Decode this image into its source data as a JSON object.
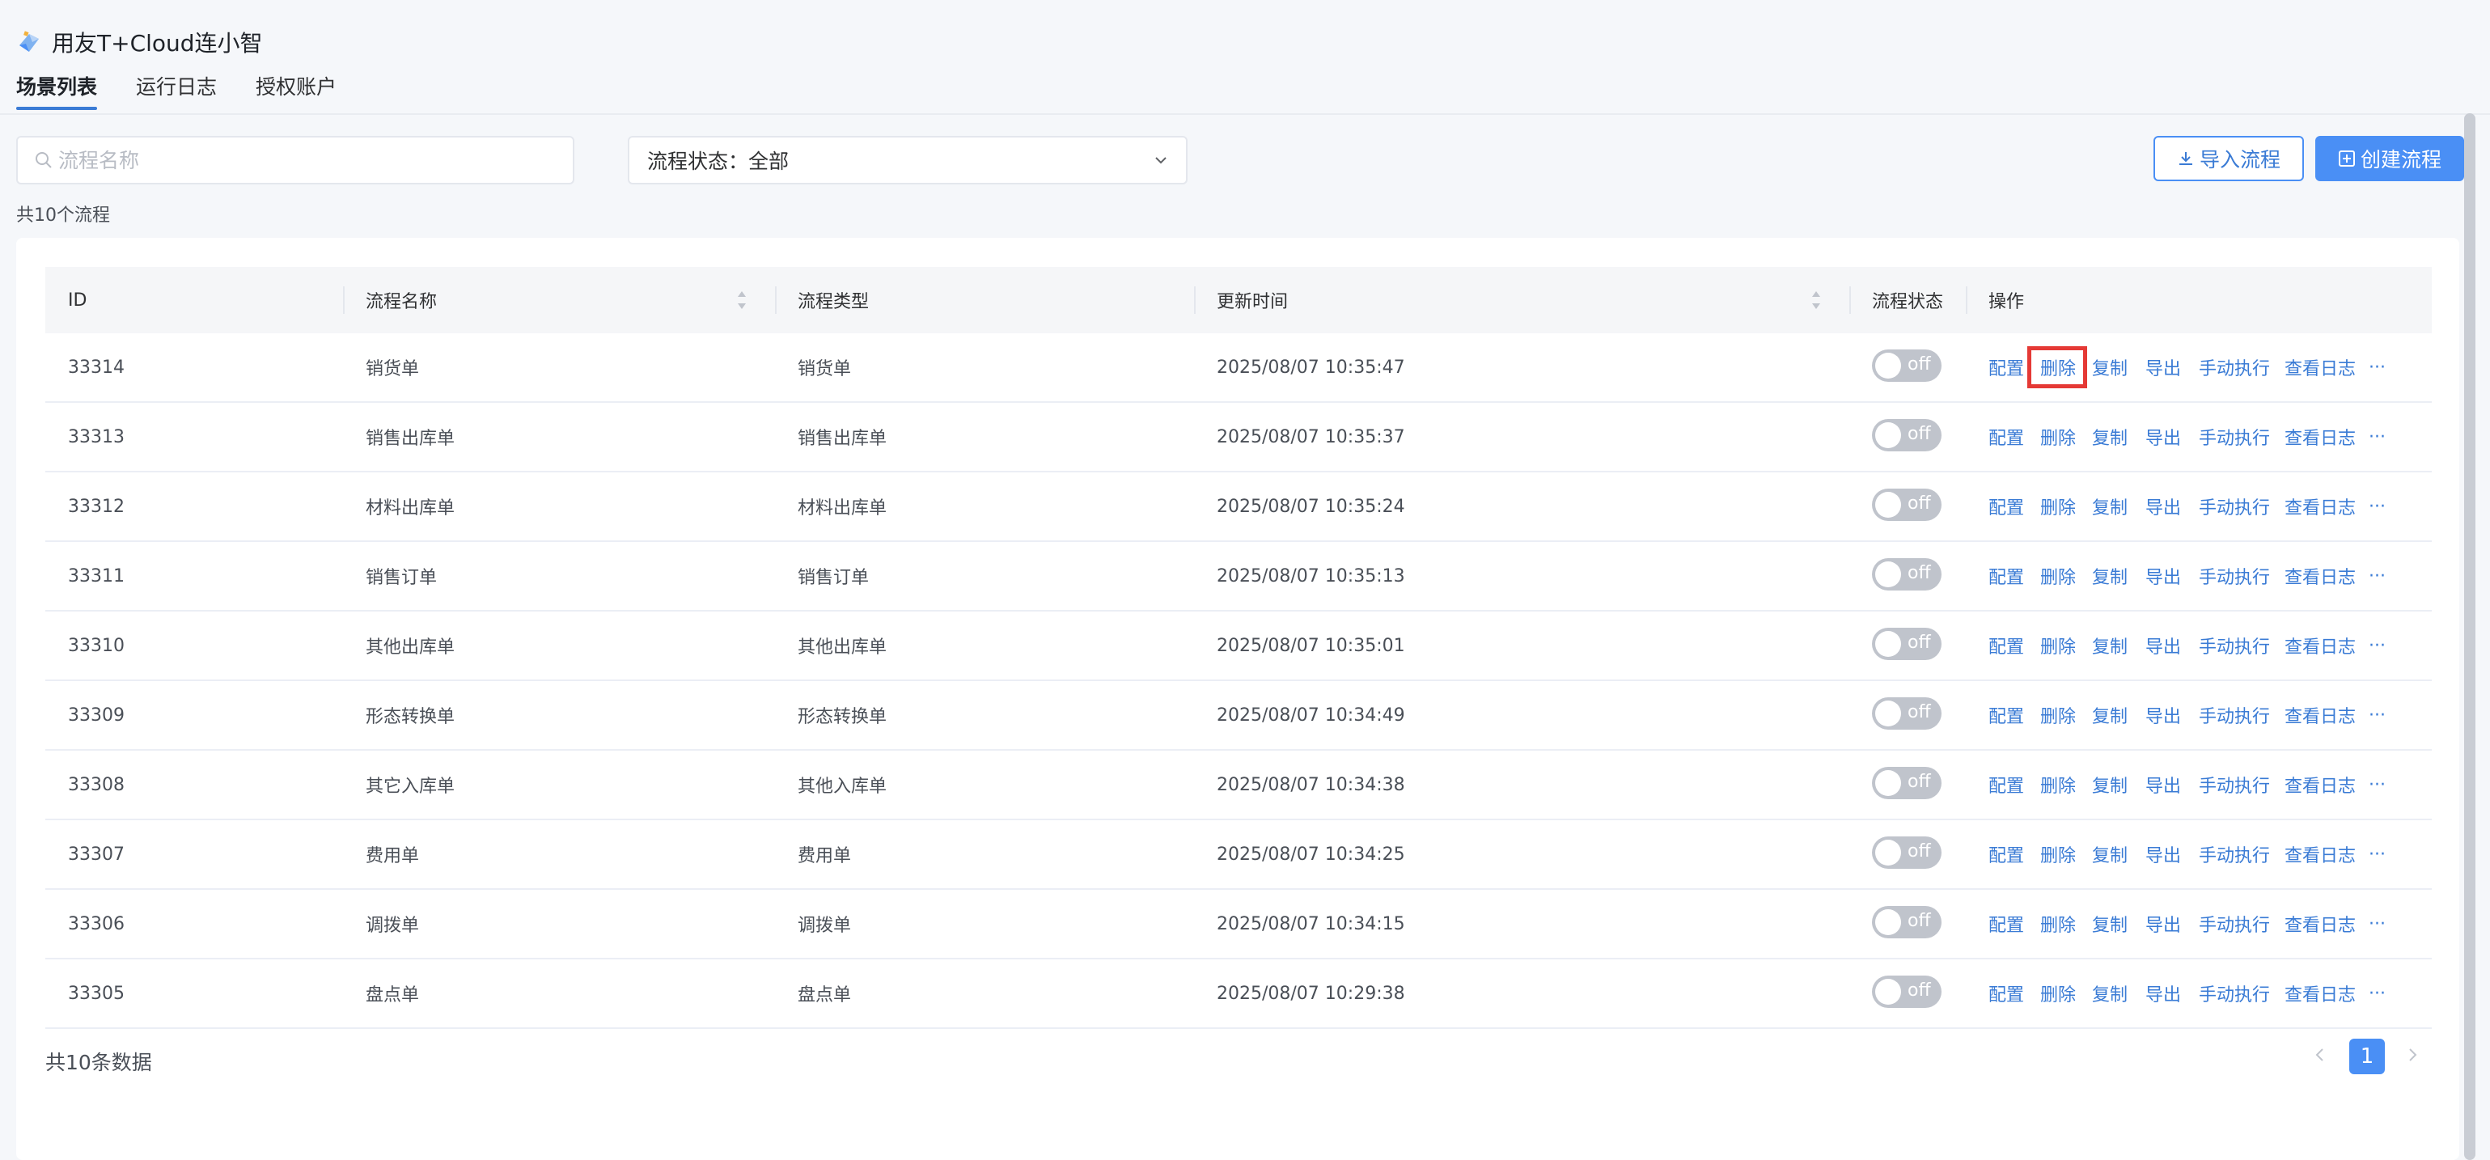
{
  "app": {
    "title": "用友T+Cloud连小智",
    "tabs": [
      {
        "label": "场景列表",
        "active": true
      },
      {
        "label": "运行日志",
        "active": false
      },
      {
        "label": "授权账户",
        "active": false
      }
    ]
  },
  "toolbar": {
    "search_placeholder": "流程名称",
    "status_filter_label": "流程状态：全部",
    "import_label": "导入流程",
    "create_label": "创建流程",
    "total_label": "共10个流程"
  },
  "table": {
    "columns": [
      "ID",
      "流程名称",
      "流程类型",
      "更新时间",
      "流程状态",
      "操作"
    ],
    "action_labels": [
      "配置",
      "删除",
      "复制",
      "导出",
      "手动执行",
      "查看日志",
      "···"
    ],
    "toggle_label": "off",
    "rows": [
      {
        "id": "33314",
        "name": "销货单",
        "type": "销货单",
        "updated": "2025/08/07 10:35:47"
      },
      {
        "id": "33313",
        "name": "销售出库单",
        "type": "销售出库单",
        "updated": "2025/08/07 10:35:37"
      },
      {
        "id": "33312",
        "name": "材料出库单",
        "type": "材料出库单",
        "updated": "2025/08/07 10:35:24"
      },
      {
        "id": "33311",
        "name": "销售订单",
        "type": "销售订单",
        "updated": "2025/08/07 10:35:13"
      },
      {
        "id": "33310",
        "name": "其他出库单",
        "type": "其他出库单",
        "updated": "2025/08/07 10:35:01"
      },
      {
        "id": "33309",
        "name": "形态转换单",
        "type": "形态转换单",
        "updated": "2025/08/07 10:34:49"
      },
      {
        "id": "33308",
        "name": "其它入库单",
        "type": "其他入库单",
        "updated": "2025/08/07 10:34:38"
      },
      {
        "id": "33307",
        "name": "费用单",
        "type": "费用单",
        "updated": "2025/08/07 10:34:25"
      },
      {
        "id": "33306",
        "name": "调拨单",
        "type": "调拨单",
        "updated": "2025/08/07 10:34:15"
      },
      {
        "id": "33305",
        "name": "盘点单",
        "type": "盘点单",
        "updated": "2025/08/07 10:29:38"
      }
    ]
  },
  "footer": {
    "total_label": "共10条数据",
    "current_page": "1"
  },
  "colors": {
    "accent": "#4a8ff5",
    "link": "#3a7bd5",
    "highlight": "#e53935",
    "toggle_off": "#c0c4cc"
  }
}
